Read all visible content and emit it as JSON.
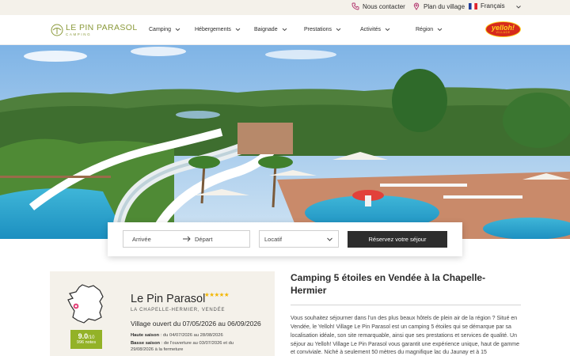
{
  "topbar": {
    "contact_label": "Nous contacter",
    "plan_label": "Plan du village",
    "language": "Français",
    "icons": {
      "contact": "phone-icon",
      "plan": "map-pin-icon",
      "language": "french-flag-icon"
    }
  },
  "logo": {
    "name": "LE PIN PARASOL",
    "sub": "CAMPING"
  },
  "nav": [
    {
      "label": "Camping"
    },
    {
      "label": "Hébergements"
    },
    {
      "label": "Baignade"
    },
    {
      "label": "Prestations"
    },
    {
      "label": "Activités"
    },
    {
      "label": "Région"
    }
  ],
  "brand": {
    "name": "yelloh!",
    "sub": "VILLAGE"
  },
  "search": {
    "arrival": "Arrivée",
    "departure": "Départ",
    "accommodation": "Locatif",
    "submit": "Réservez votre séjour"
  },
  "card": {
    "title": "Le Pin Parasol",
    "stars": "★★★★★",
    "location": "LA CHAPELLE-HERMIER, VENDÉE",
    "opening": "Village ouvert du 07/05/2026 au 06/09/2026",
    "high_season_label": "Haute saison",
    "high_season_text": " : du 04/07/2026 au 28/08/2026",
    "low_season_label": "Basse saison",
    "low_season_text": " : de l'ouverture au 03/07/2026 et du 29/08/2026 à la fermeture",
    "rating_value": "9.0",
    "rating_scale": "/10",
    "rating_count": "996 notes"
  },
  "content": {
    "headline": "Camping 5 étoiles en Vendée à la Chapelle-Hermier",
    "body": "Vous souhaitez séjourner dans l'un des plus beaux hôtels de plein air de la région ? Situé en Vendée, le Yelloh! Village Le Pin Parasol est un camping 5 étoiles qui se démarque par sa localisation idéale, son site remarquable, ainsi que ses prestations et services de qualité. Un séjour au Yelloh! Village Le Pin Parasol vous garantit une expérience unique, haut de gamme et conviviale. Niché à seulement 50 mètres du magnifique lac du Jaunay et à 15"
  },
  "colors": {
    "topbar_bg": "#f4f1ea",
    "accent_green": "#8b9a3b",
    "rating_green": "#93b227",
    "button_dark": "#2d2d2d",
    "brand_red": "#d62a1d",
    "brand_yellow": "#ffd21f",
    "map_pin": "#e2457a"
  }
}
